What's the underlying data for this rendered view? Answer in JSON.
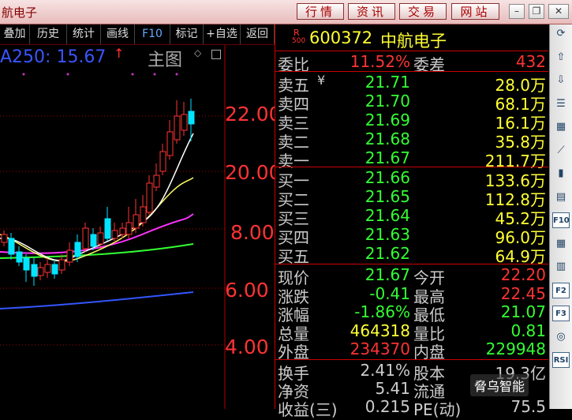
{
  "window": {
    "title": "航电子",
    "nav_buttons": [
      "行情",
      "资讯",
      "交易",
      "网站"
    ]
  },
  "toolbar": {
    "items": [
      "叠加",
      "历史",
      "统计",
      "画线",
      "F10",
      "标记",
      "+自选",
      "返回"
    ]
  },
  "chart": {
    "ma_label": "A250: 15.67",
    "ma_arrow": "↑",
    "main_label": "主图",
    "main_diamond": "◇",
    "price_labels": [
      "22.00",
      "20.00",
      "8.00",
      "6.00",
      "4.00"
    ],
    "colors": {
      "up": "#ff3333",
      "down": "#00e5ff",
      "ma5": "#ffffff",
      "ma10": "#ffff66",
      "ma20": "#ff33ff",
      "ma60": "#33ff33",
      "ma250": "#3355ff"
    }
  },
  "quote": {
    "r_badge": "R",
    "r_sub": "500",
    "code": "600372",
    "name": "中航电子",
    "ratio_label": "委比",
    "ratio_value": "11.52%",
    "diff_label": "委差",
    "diff_value": "432",
    "sell": [
      {
        "label": "卖五",
        "mark": "¥",
        "price": "21.71",
        "vol": "28.0万"
      },
      {
        "label": "卖四",
        "price": "21.70",
        "vol": "68.1万"
      },
      {
        "label": "卖三",
        "price": "21.69",
        "vol": "16.1万"
      },
      {
        "label": "卖二",
        "price": "21.68",
        "vol": "35.8万"
      },
      {
        "label": "卖一",
        "price": "21.67",
        "vol": "211.7万"
      }
    ],
    "buy": [
      {
        "label": "买一",
        "price": "21.66",
        "vol": "133.6万"
      },
      {
        "label": "买二",
        "price": "21.65",
        "vol": "112.8万"
      },
      {
        "label": "买三",
        "price": "21.64",
        "vol": "45.2万"
      },
      {
        "label": "买四",
        "price": "21.63",
        "vol": "96.0万"
      },
      {
        "label": "买五",
        "price": "21.62",
        "vol": "64.9万"
      }
    ],
    "stats": [
      {
        "l1": "现价",
        "v1": "21.67",
        "c1": "#33ff33",
        "l2": "今开",
        "v2": "22.20",
        "c2": "#ff3333"
      },
      {
        "l1": "涨跌",
        "v1": "-0.41",
        "c1": "#33ff33",
        "l2": "最高",
        "v2": "22.45",
        "c2": "#ff3333"
      },
      {
        "l1": "涨幅",
        "v1": "-1.86%",
        "c1": "#33ff33",
        "l2": "最低",
        "v2": "21.07",
        "c2": "#33ff33"
      },
      {
        "l1": "总量",
        "v1": "464318",
        "c1": "#ffff33",
        "l2": "量比",
        "v2": "0.81",
        "c2": "#33ff33"
      },
      {
        "l1": "外盘",
        "v1": "234370",
        "c1": "#ff3333",
        "l2": "内盘",
        "v2": "229948",
        "c2": "#33ff33"
      }
    ],
    "extra": [
      {
        "l1": "换手",
        "v1": "2.41%",
        "l2": "股本",
        "v2": "19.3亿"
      },
      {
        "l1": "净资",
        "v1": "5.41",
        "l2": "流通",
        "v2": ""
      },
      {
        "l1": "收益(三)",
        "v1": "0.215",
        "l2": "PE(动)",
        "v2": "75.5"
      }
    ]
  },
  "side_icons": [
    "refresh-icon",
    "up-arrow-icon",
    "down-arrow-icon",
    "list-icon",
    "grid-icon",
    "line-chart-icon",
    "candle-chart-icon",
    "table-icon",
    "f10-icon",
    "grid-icon-2",
    "book-icon",
    "f2-icon",
    "f3-icon",
    "target-icon",
    "rsi-icon"
  ],
  "side_labels": {
    "f10": "F10",
    "f2": "F2",
    "f3": "F3",
    "rsi": "RSI"
  },
  "watermark": "脅乌智能"
}
